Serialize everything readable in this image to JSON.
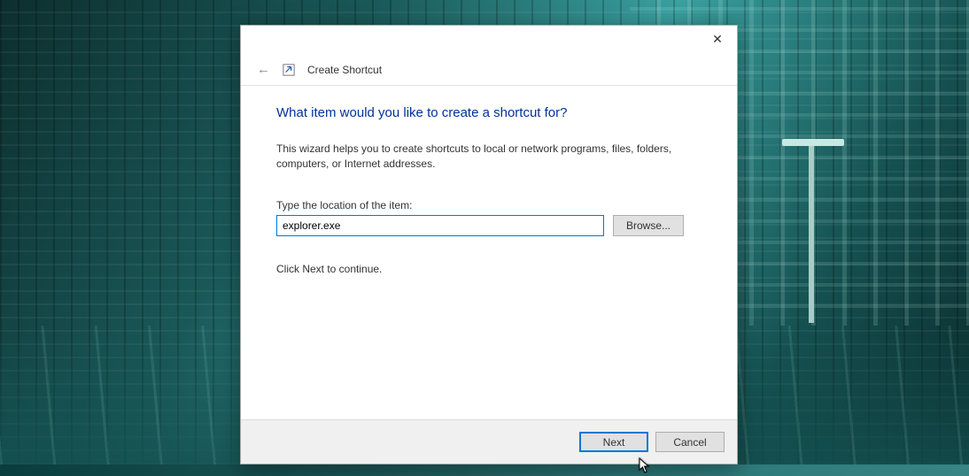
{
  "header": {
    "title": "Create Shortcut"
  },
  "main": {
    "heading": "What item would you like to create a shortcut for?",
    "description": "This wizard helps you to create shortcuts to local or network programs, files, folders, computers, or Internet addresses.",
    "field_label": "Type the location of the item:",
    "location_value": "explorer.exe",
    "browse_label": "Browse...",
    "continue_text": "Click Next to continue."
  },
  "footer": {
    "next_label": "Next",
    "cancel_label": "Cancel"
  }
}
